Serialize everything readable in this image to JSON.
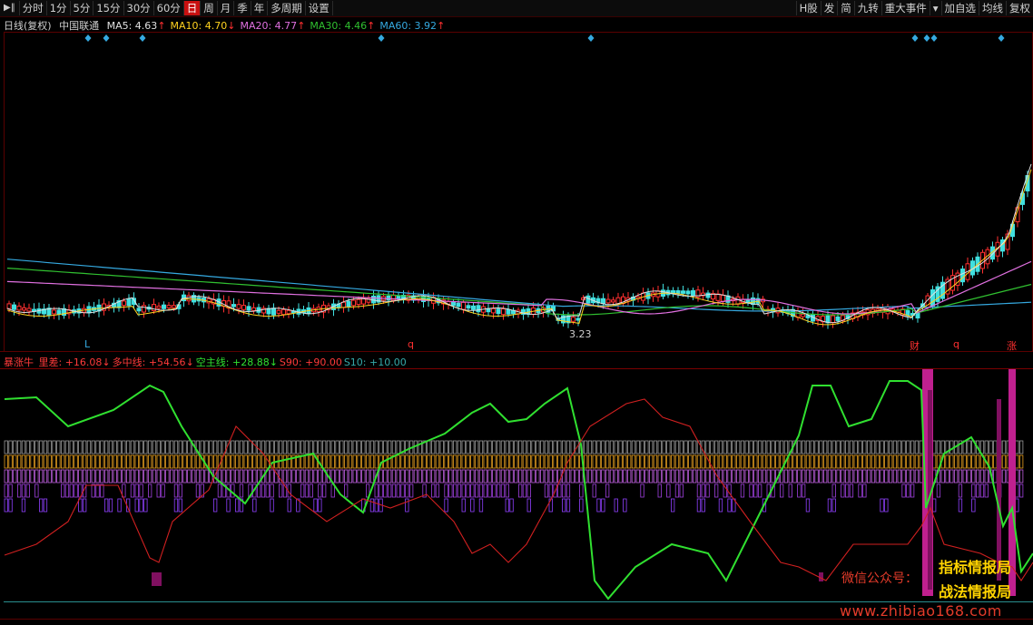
{
  "toolbar": {
    "items": [
      "分时",
      "1分",
      "5分",
      "15分",
      "30分",
      "60分",
      "日",
      "周",
      "月",
      "季",
      "年",
      "多周期",
      "设置"
    ],
    "active": "日",
    "right_items": [
      "H股",
      "发",
      "简",
      "九转",
      "重大事件",
      "▾",
      "加自选",
      "均线",
      "复权"
    ]
  },
  "kline_header": {
    "period": "日线(复权)",
    "stock_name": "中国联通",
    "ma": [
      {
        "label": "MA5: 4.63",
        "arrow": "↑",
        "color": "#e0e0e0"
      },
      {
        "label": "MA10: 4.70",
        "arrow": "↓",
        "color": "#ffd21f"
      },
      {
        "label": "MA20: 4.77",
        "arrow": "↑",
        "color": "#e070e0"
      },
      {
        "label": "MA30: 4.46",
        "arrow": "↑",
        "color": "#30c030"
      },
      {
        "label": "MA60: 3.92",
        "arrow": "↑",
        "color": "#35a9e0"
      }
    ]
  },
  "low_marker": "3.23",
  "event_markers": [
    {
      "text": "L",
      "color": "#35a9e0"
    },
    {
      "text": "q",
      "color": "#ff3030"
    },
    {
      "text": "财",
      "color": "#ff3030"
    },
    {
      "text": "q",
      "color": "#ff3030"
    },
    {
      "text": "涨",
      "color": "#ff3030"
    }
  ],
  "indicator": {
    "name": "暴涨牛",
    "items": [
      {
        "label": "里差: +16.08",
        "arrow": "↓",
        "color": "#ff3a3a"
      },
      {
        "label": "多中线: +54.56",
        "arrow": "↓",
        "color": "#ff3a3a"
      },
      {
        "label": "空主线: +28.88",
        "arrow": "↓",
        "color": "#30e030"
      },
      {
        "label": "S90: +90.00",
        "arrow": "",
        "color": "#ff3a3a"
      },
      {
        "label": "S10: +10.00",
        "arrow": "",
        "color": "#35a9a9"
      }
    ]
  },
  "watermark": {
    "wechat": "微信公众号：",
    "brand1": "指标情报局",
    "brand2": "战法情报局",
    "url": "www.zhibiao168.com"
  },
  "colors": {
    "up": "#ff3030",
    "down": "#40e0e0",
    "accent": "#c81010"
  }
}
